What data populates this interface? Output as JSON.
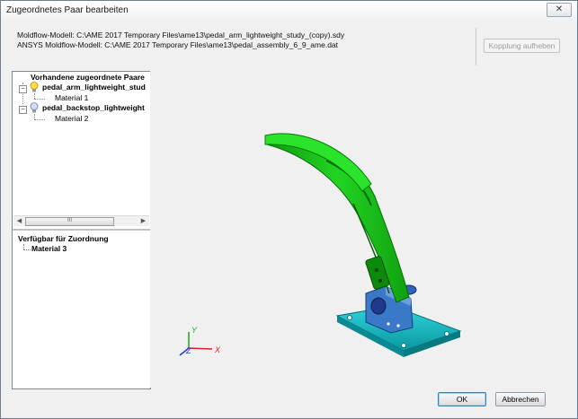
{
  "window": {
    "title": "Zugeordnetes Paar bearbeiten",
    "close_symbol": "✕"
  },
  "models": {
    "moldflow_line": "Moldflow-Modell: C:\\AME 2017 Temporary Files\\ame13\\pedal_arm_lightweight_study_(copy).sdy",
    "ansys_line": "ANSYS Moldflow-Modell:  C:\\AME 2017 Temporary Files\\ame13\\pedal_assembly_6_9_ame.dat"
  },
  "buttons": {
    "decouple": "Kopplung aufheben",
    "ok": "OK",
    "cancel": "Abbrechen"
  },
  "existing_pairs": {
    "header": "Vorhandene zugeordnete Paare",
    "pairs": [
      {
        "name": "pedal_arm_lightweight_stud",
        "material": "Material 1"
      },
      {
        "name": "pedal_backstop_lightweight",
        "material": "Material 2"
      }
    ],
    "scroll_thumb_label": "III"
  },
  "available": {
    "header": "Verfügbar für Zuordnung",
    "items": [
      "Material 3"
    ]
  },
  "axes": {
    "y": "Y",
    "z": "Z",
    "x": "X"
  },
  "colors": {
    "part_green": "#1fc91f",
    "base_cyan": "#12bcc4",
    "bracket_blue": "#3a75c7",
    "axis_x": "#e02020",
    "axis_y": "#20b020",
    "axis_z": "#2040d0"
  }
}
